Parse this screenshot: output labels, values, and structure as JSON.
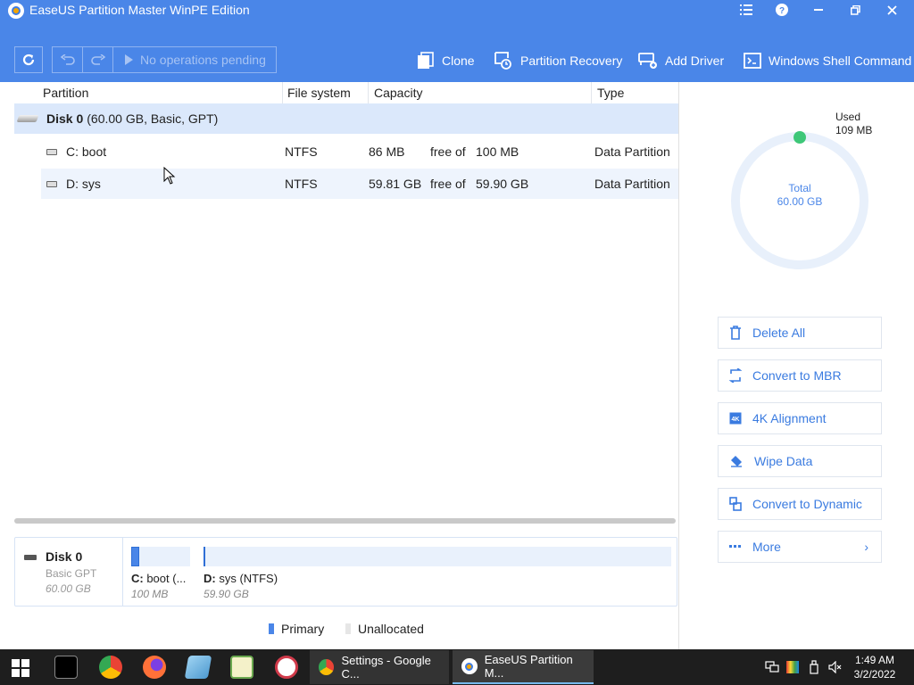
{
  "window": {
    "title": "EaseUS Partition Master WinPE Edition"
  },
  "toolbar": {
    "pending_label": "No operations pending",
    "clone_label": "Clone",
    "partition_recovery_label": "Partition Recovery",
    "add_driver_label": "Add Driver",
    "shell_command_label": "Windows Shell Command"
  },
  "table": {
    "columns": [
      "Partition",
      "File system",
      "Capacity",
      "Type"
    ],
    "disk": {
      "name": "Disk 0",
      "detail": "(60.00 GB, Basic, GPT)"
    },
    "rows": [
      {
        "name": "C: boot",
        "fs": "NTFS",
        "free": "86 MB",
        "free_of": "free of",
        "total": "100 MB",
        "type": "Data Partition"
      },
      {
        "name": "D: sys",
        "fs": "NTFS",
        "free": "59.81 GB",
        "free_of": "free of",
        "total": "59.90 GB",
        "type": "Data Partition"
      }
    ]
  },
  "usage": {
    "used_label": "Used",
    "used_value": "109 MB",
    "total_label": "Total",
    "total_value": "60.00 GB",
    "used_fraction": 0.0018
  },
  "operations": [
    {
      "label": "Delete All"
    },
    {
      "label": "Convert to MBR"
    },
    {
      "label": "4K Alignment"
    },
    {
      "label": "Wipe Data"
    },
    {
      "label": "Convert to Dynamic"
    },
    {
      "label": "More"
    }
  ],
  "diskmap": {
    "disk_name": "Disk 0",
    "disk_type": "Basic GPT",
    "disk_size": "60.00 GB",
    "segments": [
      {
        "name_prefix": "C:",
        "name_rest": " boot (...",
        "size": "100 MB",
        "used_fraction": 0.14
      },
      {
        "name_prefix": "D:",
        "name_rest": " sys (NTFS)",
        "size": "59.90 GB",
        "used_fraction": 0.0015
      }
    ]
  },
  "legend": {
    "primary": "Primary",
    "unallocated": "Unallocated"
  },
  "taskbar": {
    "items": [
      {
        "label": "Settings - Google C..."
      },
      {
        "label": "EaseUS Partition M..."
      }
    ],
    "time": "1:49 AM",
    "date": "3/2/2022"
  },
  "colors": {
    "accent": "#4a86e8",
    "used_indicator": "#3ec778",
    "taskbar": "#1e1e1e"
  }
}
